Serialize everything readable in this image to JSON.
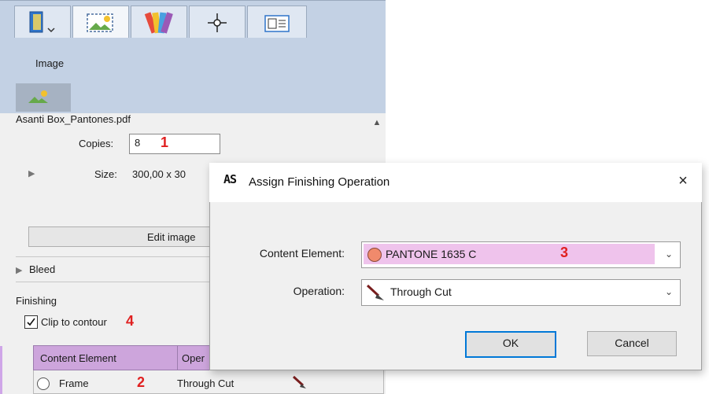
{
  "panel": {
    "tabs": [
      {
        "icon": "page-layout-icon"
      },
      {
        "icon": "image-icon"
      },
      {
        "icon": "color-swatches-icon"
      },
      {
        "icon": "crosshair-icon"
      },
      {
        "icon": "frame-layout-icon"
      }
    ],
    "image_section_title": "Image",
    "filename": "Asanti Box_Pantones.pdf",
    "copies_label": "Copies:",
    "copies_value": "8",
    "size_label": "Size:",
    "size_value": "300,00 x 30",
    "edit_button": "Edit image",
    "bleed_label": "Bleed",
    "finishing_label": "Finishing",
    "clip_to_contour_label": "Clip to contour",
    "clip_to_contour_checked": true,
    "table": {
      "headers": [
        "Content Element",
        "Oper"
      ],
      "rows": [
        {
          "element": "Frame",
          "operation": "Through Cut"
        }
      ]
    }
  },
  "annotations": [
    "1",
    "2",
    "3",
    "4"
  ],
  "dialog": {
    "logo": "AS",
    "title": "Assign Finishing Operation",
    "close_glyph": "×",
    "content_element_label": "Content Element:",
    "content_element_value": "PANTONE 1635 C",
    "content_element_color": "#f08a6c",
    "operation_label": "Operation:",
    "operation_value": "Through Cut",
    "ok_label": "OK",
    "cancel_label": "Cancel"
  },
  "colors": {
    "accent_purple": "#cda5dc",
    "highlight_pink": "#efc3ec",
    "annotation_red": "#e02020",
    "focus_blue": "#0078d7"
  }
}
